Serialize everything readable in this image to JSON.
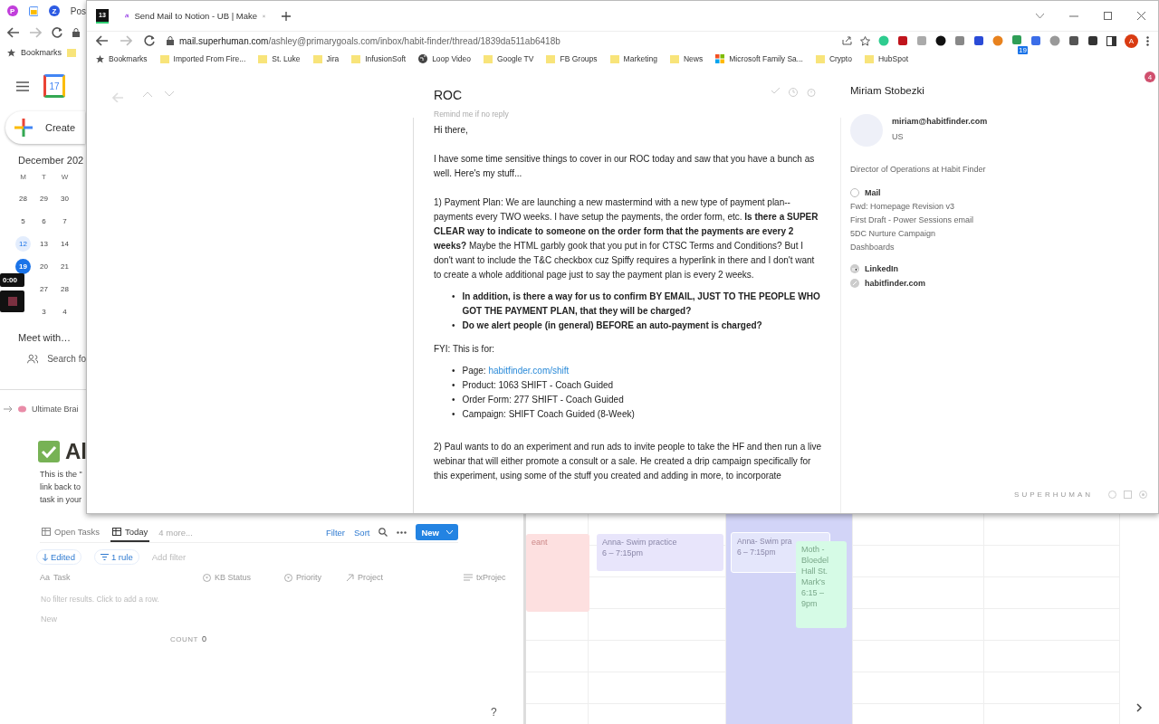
{
  "back_browser": {
    "tab_badges": [
      "P",
      "Z"
    ],
    "tab_title": "Pos",
    "bookmarks_label": "Bookmarks"
  },
  "calendar_sidebar": {
    "logo_day": "17",
    "create": "Create",
    "month": "December 202",
    "weekdays": [
      "M",
      "T",
      "W"
    ],
    "rows": [
      {
        "cells": [
          {
            "label": "28",
            "selected": false,
            "highlighted": false
          },
          {
            "label": "29",
            "selected": false,
            "highlighted": false
          },
          {
            "label": "30",
            "selected": false,
            "highlighted": false
          }
        ]
      },
      {
        "cells": [
          {
            "label": "5",
            "selected": false,
            "highlighted": false
          },
          {
            "label": "6",
            "selected": false,
            "highlighted": false
          },
          {
            "label": "7",
            "selected": false,
            "highlighted": false
          }
        ]
      },
      {
        "cells": [
          {
            "label": "12",
            "selected": false,
            "highlighted": true
          },
          {
            "label": "13",
            "selected": false,
            "highlighted": false
          },
          {
            "label": "14",
            "selected": false,
            "highlighted": false
          }
        ]
      },
      {
        "cells": [
          {
            "label": "19",
            "selected": true,
            "highlighted": false
          },
          {
            "label": "20",
            "selected": false,
            "highlighted": false
          },
          {
            "label": "21",
            "selected": false,
            "highlighted": false
          }
        ]
      },
      {
        "cells": [
          {
            "label": "27",
            "selected": false,
            "highlighted": false
          },
          {
            "label": "28",
            "selected": false,
            "highlighted": false
          }
        ]
      },
      {
        "cells": [
          {
            "label": "3",
            "selected": false,
            "highlighted": false
          },
          {
            "label": "4",
            "selected": false,
            "highlighted": false
          }
        ]
      }
    ],
    "meet": "Meet with…",
    "search": "Search fo"
  },
  "video_overlay": {
    "time": "0:00"
  },
  "notion": {
    "breadcrumb": "Ultimate Brai",
    "title": "Al",
    "description": [
      "This is the \"",
      "link back to",
      "task in your"
    ],
    "views": [
      {
        "label": "Open Tasks",
        "selected": false
      },
      {
        "label": "Today",
        "selected": true
      }
    ],
    "more_views": "4 more...",
    "filter": "Filter",
    "sort": "Sort",
    "new": "New",
    "sort_chip": "Edited",
    "rule_chip": "1 rule",
    "add_filter": "Add filter",
    "columns": [
      {
        "kind": "title",
        "icon_text": "Aa",
        "label": "Task"
      },
      {
        "kind": "status",
        "label": "KB Status"
      },
      {
        "kind": "select",
        "label": "Priority"
      },
      {
        "kind": "relation",
        "label": "Project"
      },
      {
        "kind": "text",
        "label": "txProjec"
      }
    ],
    "empty": "No filter results. Click to add a row.",
    "new_row": "New",
    "count_label": "COUNT",
    "count": "0",
    "help": "?"
  },
  "calendar_grid": {
    "columns": [
      {
        "selected": false
      },
      {
        "selected": false
      },
      {
        "selected": true
      },
      {
        "selected": false
      },
      {
        "selected": false
      }
    ],
    "events": [
      {
        "title": "eant",
        "color": "#fde0e0"
      },
      {
        "title": "Anna- Swim practice",
        "time": "6 – 7:15pm",
        "color": "#e8e5fb"
      },
      {
        "title": "Anna- Swim pra",
        "time": "6 – 7:15pm",
        "color": "#e4e6fb"
      },
      {
        "title": "Moth - Bloedel Hall St. Mark's",
        "time": "6:15 – 9pm",
        "color": "#d6fbe6"
      }
    ]
  },
  "browser": {
    "pinned_tab": "13",
    "tabs": [
      {
        "title": "Send Mail to Notion - UB | Make",
        "selected": true
      }
    ],
    "url_host": "mail.superhuman.com",
    "url_path": "/ashley@primarygoals.com/inbox/habit-finder/thread/1839da511ab6418b",
    "extension_badge": "19",
    "profile": "A",
    "bookmarks": [
      {
        "kind": "star",
        "label": "Bookmarks"
      },
      {
        "kind": "folder",
        "label": "Imported From Fire..."
      },
      {
        "kind": "folder",
        "label": "St. Luke"
      },
      {
        "kind": "folder",
        "label": "Jira"
      },
      {
        "kind": "folder",
        "label": "InfusionSoft"
      },
      {
        "kind": "globe",
        "label": "Loop Video"
      },
      {
        "kind": "folder",
        "label": "Google TV"
      },
      {
        "kind": "folder",
        "label": "FB Groups"
      },
      {
        "kind": "folder",
        "label": "Marketing"
      },
      {
        "kind": "folder",
        "label": "News"
      },
      {
        "kind": "windows",
        "label": "Microsoft Family Sa..."
      },
      {
        "kind": "folder",
        "label": "Crypto"
      },
      {
        "kind": "folder",
        "label": "HubSpot"
      }
    ]
  },
  "email": {
    "subject": "ROC",
    "reminder": "Remind me if no reply",
    "body": [
      {
        "kind": "p",
        "text": "Hi there,"
      },
      {
        "kind": "p",
        "text": "I have some time sensitive things to cover in our ROC today and saw that you have a bunch as well. Here's my stuff..."
      },
      {
        "kind": "p",
        "text": "1) Payment Plan: We are launching a new mastermind with a new type of payment plan--payments every TWO weeks. I have setup the payments, the order form, etc. **Is there a SUPER CLEAR way to indicate to someone on the order form that the payments are every 2 weeks?** Maybe the HTML garbly gook that you put in  for CTSC Terms and Conditions? But I don't want to include the T&C checkbox cuz Spiffy requires a hyperlink in there and I don't want to create a whole additional page just to say the payment plan is every 2 weeks."
      },
      {
        "kind": "ul",
        "bullet": "•",
        "items": [
          {
            "text": "In addition, is there a way for us to confirm BY EMAIL, JUST TO THE PEOPLE WHO GOT THE PAYMENT PLAN, that they will be charged?",
            "bold": true
          },
          {
            "text": "Do we alert people (in general) BEFORE an auto-payment is charged?",
            "bold": true
          }
        ]
      },
      {
        "kind": "p",
        "text": "FYI: This is for:"
      },
      {
        "kind": "ul",
        "bullet": "•",
        "items": [
          {
            "text": "Page: ",
            "link": "habitfinder.com/shift",
            "bold": false
          },
          {
            "text": "Product: 1063 SHIFT - Coach Guided",
            "bold": false
          },
          {
            "text": "Order Form: 277 SHIFT - Coach Guided",
            "bold": false
          },
          {
            "text": "Campaign: SHIFT Coach Guided (8-Week)",
            "bold": false
          }
        ]
      },
      {
        "kind": "gap"
      },
      {
        "kind": "p",
        "text": "2) Paul wants to do an experiment and run ads to invite people to take the HF and then run a live webinar that will either promote a consult or a sale. He created a drip campaign specifically for this experiment, using some of the stuff you created and adding in more, to incorporate"
      }
    ]
  },
  "contact": {
    "name": "Miriam Stobezki",
    "email": "miriam@habitfinder.com",
    "country": "US",
    "role": "Director of Operations at Habit Finder",
    "mail_label": "Mail",
    "mail_items": [
      "Fwd: Homepage Revision v3",
      "First Draft - Power Sessions email",
      "5DC Nurture Campaign",
      "Dashboards"
    ],
    "links": [
      {
        "kind": "linkedin",
        "label": "LinkedIn"
      },
      {
        "kind": "web",
        "label": "habitfinder.com"
      }
    ]
  },
  "footer": {
    "brand": "SUPERHUMAN"
  },
  "notification_badge": "4"
}
